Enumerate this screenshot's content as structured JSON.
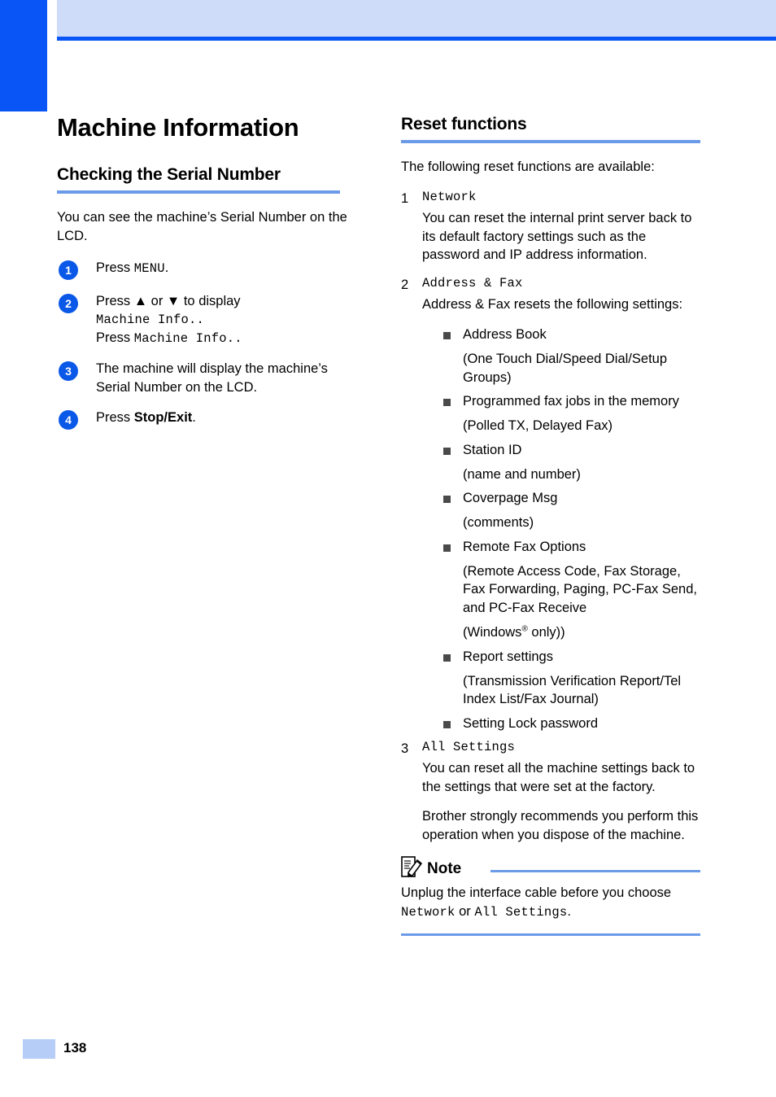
{
  "page": {
    "number": "138",
    "chapter_title": "Machine Information"
  },
  "colors": {
    "tab_blue": "#0a55f5",
    "header_band": "#cedcfa",
    "heading_rule": "#6b9ae8",
    "step_circle": "#0a58e8",
    "bullet": "#4a4a4a",
    "footer_swatch": "#b6cdf8"
  },
  "left_column": {
    "section_title": "Checking the Serial Number",
    "intro": "You can see the machine’s Serial Number on the LCD.",
    "steps": [
      {
        "num": "1",
        "lines": [
          {
            "parts": [
              {
                "text": "Press ",
                "style": "plain"
              },
              {
                "text": "MENU",
                "style": "mono"
              },
              {
                "text": ".",
                "style": "plain"
              }
            ]
          }
        ]
      },
      {
        "num": "2",
        "lines": [
          {
            "parts": [
              {
                "text": "Press ▲ or ▼ to display",
                "style": "plain"
              }
            ]
          },
          {
            "parts": [
              {
                "text": "Machine Info..",
                "style": "mono"
              }
            ]
          },
          {
            "parts": [
              {
                "text": "Press ",
                "style": "plain"
              },
              {
                "text": "Machine Info..",
                "style": "mono"
              }
            ]
          }
        ]
      },
      {
        "num": "3",
        "lines": [
          {
            "parts": [
              {
                "text": "The machine will display the machine’s Serial Number on the LCD.",
                "style": "plain"
              }
            ]
          }
        ]
      },
      {
        "num": "4",
        "lines": [
          {
            "parts": [
              {
                "text": "Press ",
                "style": "plain"
              },
              {
                "text": "Stop/Exit",
                "style": "bold"
              },
              {
                "text": ".",
                "style": "plain"
              }
            ]
          }
        ]
      }
    ]
  },
  "right_column": {
    "section_title": "Reset functions",
    "intro": "The following reset functions are available:",
    "items": [
      {
        "num": "1",
        "label": "Network",
        "paragraphs": [
          "You can reset the internal print server back to its default factory settings such as the password and IP address information."
        ],
        "bullets": []
      },
      {
        "num": "2",
        "label": "Address & Fax",
        "paragraphs": [
          "Address & Fax resets the following settings:"
        ],
        "bullets": [
          {
            "text": "Address Book",
            "sub": "(One Touch Dial/Speed Dial/Setup Groups)"
          },
          {
            "text": "Programmed fax jobs in the memory",
            "sub": "(Polled TX, Delayed Fax)"
          },
          {
            "text": "Station ID",
            "sub": "(name and number)"
          },
          {
            "text": "Coverpage Msg",
            "sub": "(comments)"
          },
          {
            "text": "Remote Fax Options",
            "sub": "(Remote Access Code, Fax Storage, Fax Forwarding, Paging, PC-Fax Send, and PC-Fax Receive",
            "sub2_prefix": "(Windows",
            "sub2_sup": "®",
            "sub2_suffix": " only))"
          },
          {
            "text": "Report settings",
            "sub": "(Transmission Verification Report/Tel Index List/Fax Journal)"
          },
          {
            "text": "Setting Lock password",
            "sub": ""
          }
        ]
      },
      {
        "num": "3",
        "label": "All Settings",
        "paragraphs": [
          "You can reset all the machine settings back to the settings that were set at the factory.",
          "Brother strongly recommends you perform this operation when you dispose of the machine."
        ],
        "bullets": []
      }
    ],
    "note": {
      "label": "Note",
      "text_prefix": "Unplug the interface cable before you choose ",
      "mono_1": "Network",
      "text_mid": " or ",
      "mono_2": "All Settings",
      "text_suffix": "."
    }
  }
}
